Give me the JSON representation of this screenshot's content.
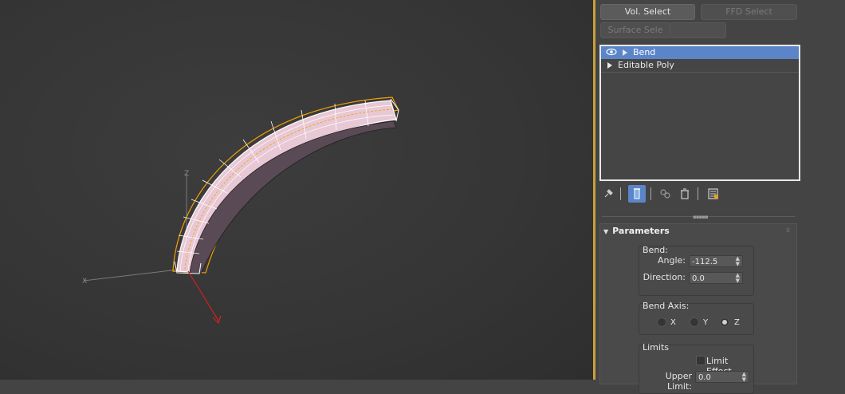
{
  "viewport": {
    "axis_x_label": "X",
    "axis_z_label": "Z"
  },
  "modify_panel": {
    "buttons": {
      "vol_select": "Vol. Select",
      "ffd_select": "FFD Select",
      "surface_select": "Surface Sele"
    },
    "modifier_stack": [
      {
        "label": "Bend",
        "selected": true
      },
      {
        "label": "Editable Poly",
        "selected": false
      }
    ],
    "parameters": {
      "title": "Parameters",
      "bend_group": {
        "label": "Bend:",
        "angle_label": "Angle:",
        "angle_value": "-112.5",
        "direction_label": "Direction:",
        "direction_value": "0.0"
      },
      "bend_axis_group": {
        "label": "Bend Axis:",
        "options": [
          "X",
          "Y",
          "Z"
        ],
        "selected": "Z"
      },
      "limits_group": {
        "label": "Limits",
        "limit_effect_label": "Limit Effect",
        "limit_effect_checked": false,
        "upper_limit_label": "Upper Limit:",
        "upper_limit_value": "0.0"
      }
    }
  },
  "colors": {
    "accent": "#5b85c8",
    "divider": "#c9a13a",
    "selection_outline": "#f0a000",
    "mesh_fill": "#e8c8d4",
    "gizmo_arrow": "#d02020"
  }
}
